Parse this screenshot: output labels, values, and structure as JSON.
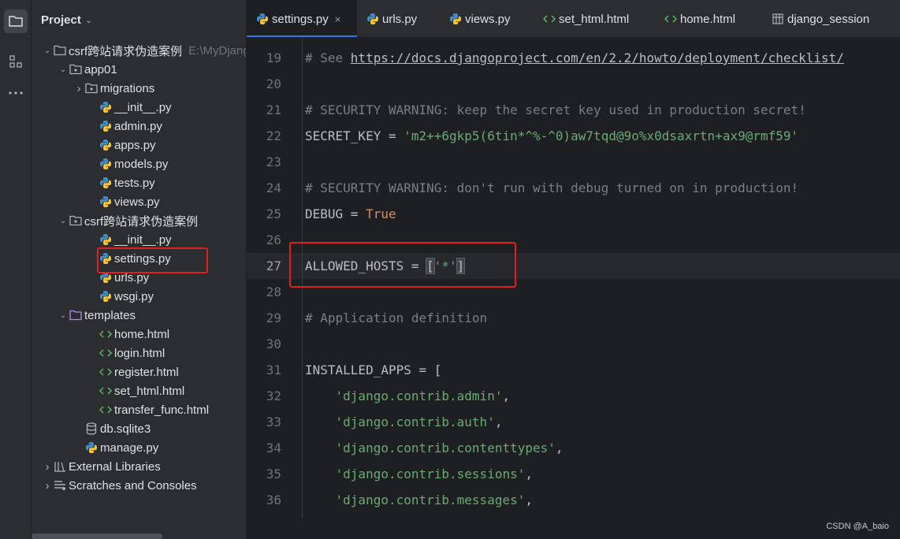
{
  "project": {
    "header": "Project",
    "tree": [
      {
        "label": "csrf跨站请求伪造案例",
        "hint": "E:\\MyDjang",
        "icon": "folder-icon",
        "expanded": true
      },
      {
        "label": "app01",
        "icon": "package-icon",
        "expanded": true
      },
      {
        "label": "migrations",
        "icon": "package-icon",
        "expanded": false
      },
      {
        "label": "__init__.py",
        "icon": "python-file-icon"
      },
      {
        "label": "admin.py",
        "icon": "python-file-icon"
      },
      {
        "label": "apps.py",
        "icon": "python-file-icon"
      },
      {
        "label": "models.py",
        "icon": "python-file-icon"
      },
      {
        "label": "tests.py",
        "icon": "python-file-icon"
      },
      {
        "label": "views.py",
        "icon": "python-file-icon"
      },
      {
        "label": "csrf跨站请求伪造案例",
        "icon": "package-icon",
        "expanded": true
      },
      {
        "label": "__init__.py",
        "icon": "python-file-icon"
      },
      {
        "label": "settings.py",
        "icon": "python-file-icon"
      },
      {
        "label": "urls.py",
        "icon": "python-file-icon"
      },
      {
        "label": "wsgi.py",
        "icon": "python-file-icon"
      },
      {
        "label": "templates",
        "icon": "template-folder-icon",
        "expanded": true
      },
      {
        "label": "home.html",
        "icon": "html-file-icon"
      },
      {
        "label": "login.html",
        "icon": "html-file-icon"
      },
      {
        "label": "register.html",
        "icon": "html-file-icon"
      },
      {
        "label": "set_html.html",
        "icon": "html-file-icon"
      },
      {
        "label": "transfer_func.html",
        "icon": "html-file-icon"
      },
      {
        "label": "db.sqlite3",
        "icon": "database-icon"
      },
      {
        "label": "manage.py",
        "icon": "python-file-icon"
      },
      {
        "label": "External Libraries",
        "icon": "library-icon",
        "expanded": false
      },
      {
        "label": "Scratches and Consoles",
        "icon": "scratches-icon",
        "expanded": false
      }
    ]
  },
  "tabs": [
    {
      "label": "settings.py",
      "icon": "python-file-icon",
      "active": true,
      "close": "×"
    },
    {
      "label": "urls.py",
      "icon": "python-file-icon"
    },
    {
      "label": "views.py",
      "icon": "python-file-icon"
    },
    {
      "label": "set_html.html",
      "icon": "html-file-icon"
    },
    {
      "label": "home.html",
      "icon": "html-file-icon"
    },
    {
      "label": "django_session",
      "icon": "table-icon"
    }
  ],
  "editor": {
    "lines": [
      {
        "n": "19",
        "parts": [
          [
            "cm",
            "# See "
          ],
          [
            "lnk",
            "https://docs.djangoproject.com/en/2.2/howto/deployment/checklist/"
          ]
        ]
      },
      {
        "n": "20",
        "parts": []
      },
      {
        "n": "21",
        "parts": [
          [
            "cm",
            "# SECURITY WARNING: keep the secret key used in production secret!"
          ]
        ]
      },
      {
        "n": "22",
        "parts": [
          [
            "plain",
            "SECRET_KEY = "
          ],
          [
            "str",
            "'m2++6gkp5(6tin*^%-^0)aw7tqd@9o%x0dsaxrtn+ax9@rmf59'"
          ]
        ]
      },
      {
        "n": "23",
        "parts": []
      },
      {
        "n": "24",
        "parts": [
          [
            "cm",
            "# SECURITY WARNING: don't run with debug turned on in production!"
          ]
        ]
      },
      {
        "n": "25",
        "parts": [
          [
            "plain",
            "DEBUG = "
          ],
          [
            "kw",
            "True"
          ]
        ]
      },
      {
        "n": "26",
        "parts": []
      },
      {
        "n": "27",
        "current": true,
        "parts": [
          [
            "plain",
            "ALLOWED_HOSTS = "
          ],
          [
            "bkt",
            "["
          ],
          [
            "str",
            "'*'"
          ],
          [
            "bkt",
            "]"
          ]
        ]
      },
      {
        "n": "28",
        "parts": []
      },
      {
        "n": "29",
        "parts": [
          [
            "cm",
            "# Application definition"
          ]
        ]
      },
      {
        "n": "30",
        "parts": []
      },
      {
        "n": "31",
        "parts": [
          [
            "plain",
            "INSTALLED_APPS = ["
          ]
        ]
      },
      {
        "n": "32",
        "parts": [
          [
            "plain",
            "    "
          ],
          [
            "str",
            "'django.contrib.admin'"
          ],
          [
            "plain",
            ","
          ]
        ]
      },
      {
        "n": "33",
        "parts": [
          [
            "plain",
            "    "
          ],
          [
            "str",
            "'django.contrib.auth'"
          ],
          [
            "plain",
            ","
          ]
        ]
      },
      {
        "n": "34",
        "parts": [
          [
            "plain",
            "    "
          ],
          [
            "str",
            "'django.contrib.contenttypes'"
          ],
          [
            "plain",
            ","
          ]
        ]
      },
      {
        "n": "35",
        "parts": [
          [
            "plain",
            "    "
          ],
          [
            "str",
            "'django.contrib.sessions'"
          ],
          [
            "plain",
            ","
          ]
        ]
      },
      {
        "n": "36",
        "parts": [
          [
            "plain",
            "    "
          ],
          [
            "str",
            "'django.contrib.messages'"
          ],
          [
            "plain",
            ","
          ]
        ]
      }
    ]
  },
  "watermark": "CSDN @A_baio",
  "colors": {
    "accent": "#3574f0",
    "highlight_box": "#e0201f",
    "string": "#6aab73",
    "keyword": "#cf8e6d",
    "comment": "#7a7e85"
  }
}
